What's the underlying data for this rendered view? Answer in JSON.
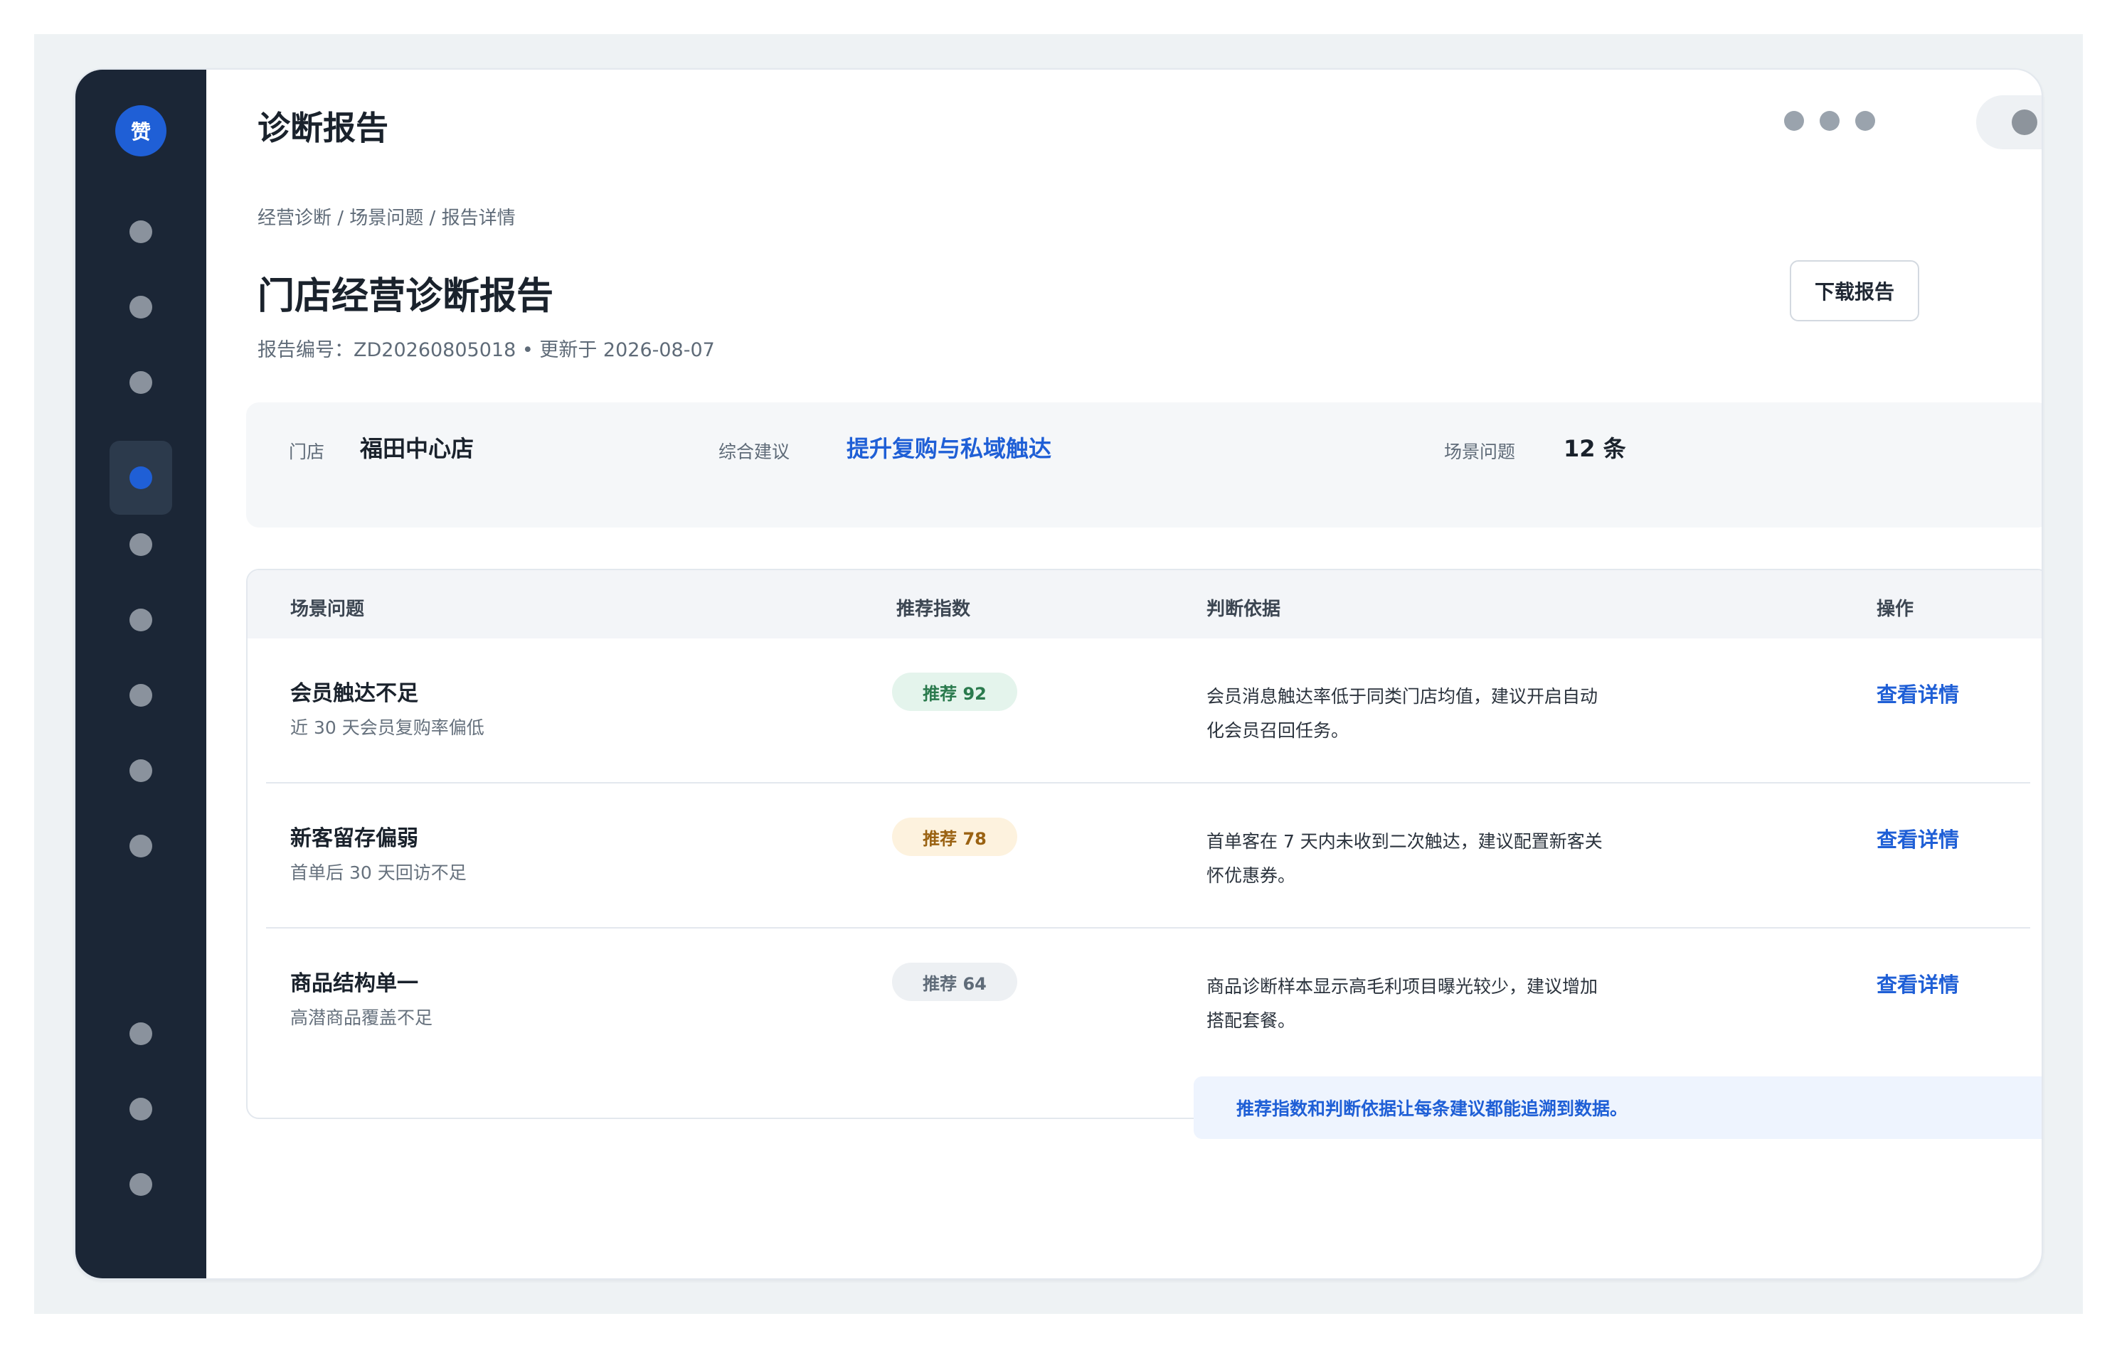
{
  "sidebar": {
    "logo_text": "赞",
    "nav_items": [
      "nav-1",
      "nav-2",
      "nav-3",
      "nav-4",
      "nav-5",
      "nav-6",
      "nav-7",
      "nav-8",
      "nav-9",
      "nav-10",
      "nav-11",
      "nav-12"
    ],
    "active_index": 3
  },
  "header": {
    "title": "诊断报告"
  },
  "breadcrumb": "经营诊断 / 场景问题 / 报告详情",
  "report": {
    "title": "门店经营诊断报告",
    "meta": "报告编号：ZD20260805018  •  更新于 2026-08-07",
    "download_label": "下载报告"
  },
  "summary": {
    "store_label": "门店",
    "store_value": "福田中心店",
    "advice_label": "综合建议",
    "advice_value": "提升复购与私域触达",
    "issues_label": "场景问题",
    "issues_value": "12 条"
  },
  "table": {
    "headers": [
      "场景问题",
      "推荐指数",
      "判断依据",
      "操作"
    ],
    "rows": [
      {
        "name": "会员触达不足",
        "sub": "近 30 天会员复购率偏低",
        "badge": "推荐 92",
        "basis": "会员消息触达率低于同类门店均值，建议开启自动化会员召回任务。",
        "action": "查看详情"
      },
      {
        "name": "新客留存偏弱",
        "sub": "首单后 30 天回访不足",
        "badge": "推荐 78",
        "basis": "首单客在 7 天内未收到二次触达，建议配置新客关怀优惠券。",
        "action": "查看详情"
      },
      {
        "name": "商品结构单一",
        "sub": "高潜商品覆盖不足",
        "badge": "推荐 64",
        "basis": "商品诊断样本显示高毛利项目曝光较少，建议增加搭配套餐。",
        "action": "查看详情"
      }
    ]
  },
  "note": "推荐指数和判断依据让每条建议都能追溯到数据。",
  "colors": {
    "sidebar_bg": "#1b2636",
    "accent": "#1f5fd6",
    "badge_high": "#2a7a4d",
    "badge_mid": "#9a6212",
    "badge_low": "#5f6b78"
  }
}
